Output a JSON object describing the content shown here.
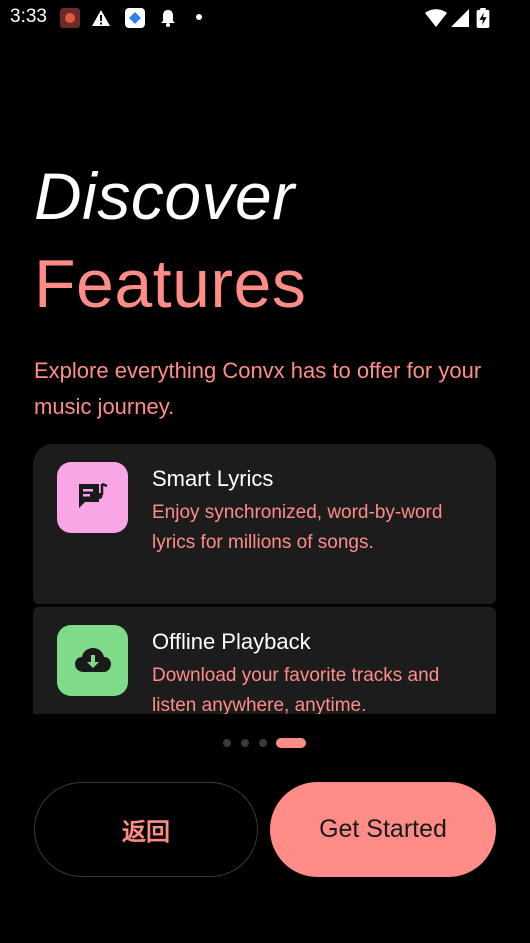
{
  "status_bar": {
    "time": "3:33",
    "icons": [
      "app-notification-icon",
      "warning-icon",
      "app-notification-icon",
      "bell-icon",
      "more-dot-icon",
      "wifi-icon",
      "signal-icon",
      "battery-charging-icon"
    ]
  },
  "headline": {
    "line1": "Discover",
    "line2": "Features"
  },
  "subtitle": "Explore everything Convx has to offer for your music journey.",
  "features": [
    {
      "title": "Smart Lyrics",
      "description": "Enjoy synchronized, word-by-word lyrics for millions of songs.",
      "icon": "lyrics-icon",
      "icon_color": "#f8a6e6"
    },
    {
      "title": "Offline Playback",
      "description": "Download your favorite tracks and listen anywhere, anytime.",
      "icon": "cloud-download-icon",
      "icon_color": "#7fdb89"
    }
  ],
  "pager": {
    "total": 4,
    "current": 4
  },
  "buttons": {
    "back_label": "返回",
    "start_label": "Get Started"
  },
  "colors": {
    "accent": "#ff8c87",
    "background": "#000000",
    "card": "#1c1c1c"
  }
}
